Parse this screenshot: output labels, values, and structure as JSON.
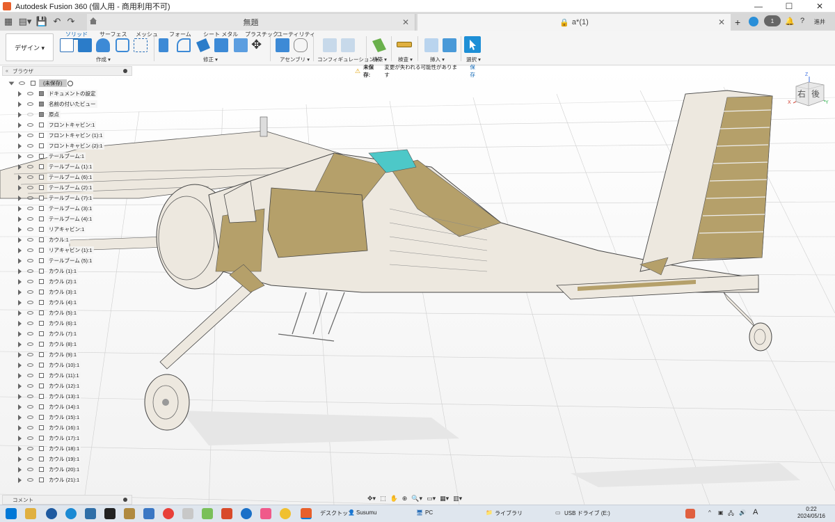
{
  "window": {
    "title": "Autodesk Fusion 360 (個人用 - 商用利用不可)"
  },
  "tabs": {
    "untitled_label": "無題",
    "active_label": "a*(1)",
    "job_count": "1",
    "user": "進井"
  },
  "ribbon": {
    "workspace": "デザイン ▾",
    "tabs": [
      "ソリッド",
      "サーフェス",
      "メッシュ",
      "フォーム",
      "シート メタル",
      "プラスチック",
      "ユーティリティ"
    ],
    "groups": {
      "create": "作成 ▾",
      "modify": "修正 ▾",
      "assemble": "アセンブリ ▾",
      "configure": "コンフィギュレーション ▾",
      "construct": "構築 ▾",
      "inspect": "検査 ▾",
      "insert": "挿入 ▾",
      "select": "選択 ▾"
    }
  },
  "unsaved": {
    "label": "未保存:",
    "message": "変更が失われる可能性があります",
    "save": "保存"
  },
  "browser": {
    "title": "ブラウザ",
    "root": "(未保存)",
    "items": [
      "ドキュメントの設定",
      "名前の付いたビュー",
      "原点",
      "フロントキャビン:1",
      "フロントキャビン (1):1",
      "フロントキャビン (2):1",
      "テールブーム:1",
      "テールブーム (1):1",
      "テールブーム (6):1",
      "テールブーム (2):1",
      "テールブーム (7):1",
      "テールブーム (3):1",
      "テールブーム (4):1",
      "リアキャビン:1",
      "カウル:1",
      "リアキャビン (1):1",
      "テールブーム (5):1",
      "カウル (1):1",
      "カウル (2):1",
      "カウル (3):1",
      "カウル (4):1",
      "カウル (5):1",
      "カウル (6):1",
      "カウル (7):1",
      "カウル (8):1",
      "カウル (9):1",
      "カウル (10):1",
      "カウル (11):1",
      "カウル (12):1",
      "カウル (13):1",
      "カウル (14):1",
      "カウル (15):1",
      "カウル (16):1",
      "カウル (17):1",
      "カウル (18):1",
      "カウル (19):1",
      "カウル (20):1",
      "カウル (21):1"
    ],
    "comment": "コメント"
  },
  "viewcube": {
    "face_right": "右",
    "face_back": "後",
    "axis_z": "Z",
    "axis_x": "X",
    "axis_y": "Y"
  },
  "taskbar": {
    "desktop": "デスクトップ",
    "user": "Susumu",
    "pc": "PC",
    "library": "ライブラリ",
    "usb": "USB ドライブ (E:)",
    "ime": "A",
    "time": "0:22",
    "date": "2024/05/16"
  },
  "colors": {
    "accent": "#0a64b4",
    "fuselage": "#ede8df",
    "fabric": "#b5a06a",
    "glass": "#4dc8c8",
    "orange": "#e8602c"
  }
}
